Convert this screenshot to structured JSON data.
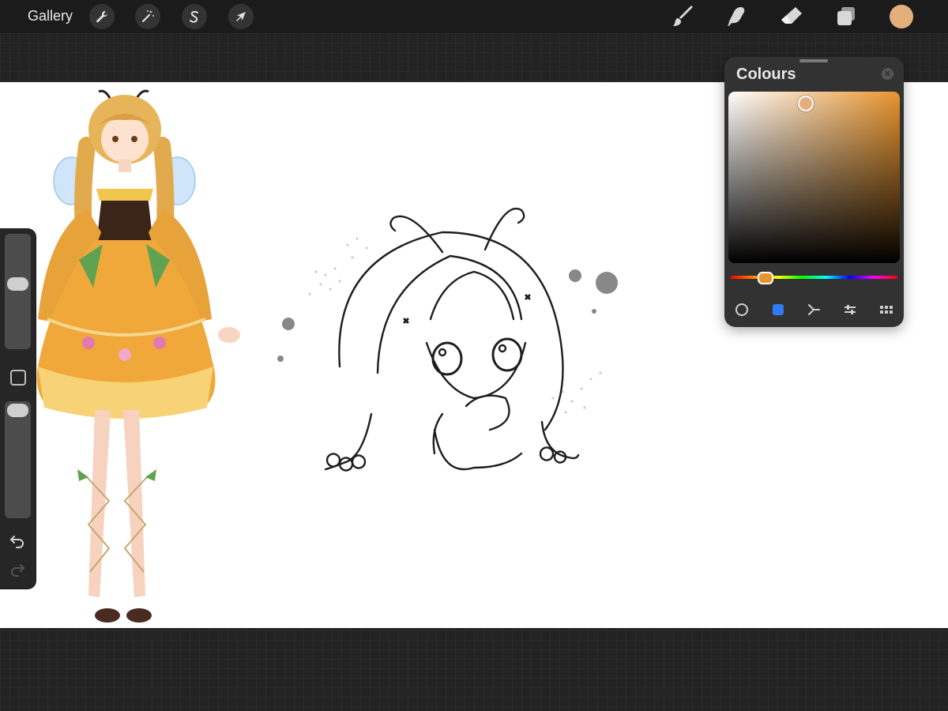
{
  "topbar": {
    "gallery_label": "Gallery",
    "current_color": "#e3b07c"
  },
  "colours_panel": {
    "title": "Colours",
    "current_color": "#e3b07c",
    "hue_color": "#e8942e",
    "saturation": 0.45,
    "brightness": 0.93,
    "hue_position": 0.21,
    "active_tab": "disc"
  },
  "colors": {
    "accent_blue": "#2f7bf6",
    "panel_bg": "#323232"
  }
}
